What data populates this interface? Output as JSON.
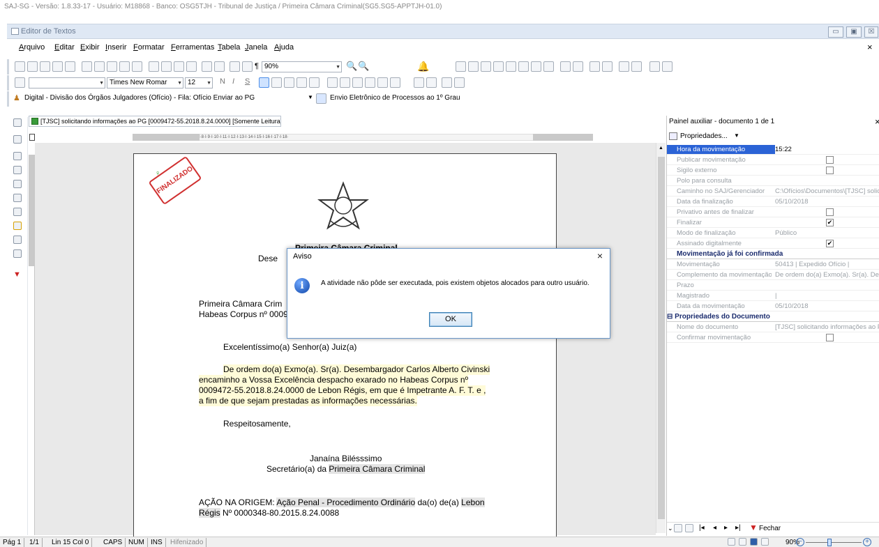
{
  "os_title": "SAJ-SG - Versão: 1.8.33-17 - Usuário: M18868 - Banco: OSG5TJH - Tribunal de Justiça / Primeira Câmara Criminal(SG5.SG5-APPTJH-01.0)",
  "editor": {
    "title": "Editor de Textos",
    "close_glyph": "×"
  },
  "menu": [
    "Arquivo",
    "Editar",
    "Exibir",
    "Inserir",
    "Formatar",
    "Ferramentas",
    "Tabela",
    "Janela",
    "Ajuda"
  ],
  "toolbar": {
    "zoom": "90%",
    "font_name": "Times New Romar",
    "font_size": "12",
    "queue_combo": "Digital - Divisão dos Órgãos Julgadores (Ofício) - Fila:  Ofício Enviar ao PG",
    "send_action": "Envio Eletrônico de Processos ao 1º Grau"
  },
  "doc_tab": "[TJSC] solicitando informações ao PG [0009472-55.2018.8.24.0000] [Somente Leitura]",
  "ruler_text": "·3·I·2·I·1·I··I·1·I·2·I·3·I·4·I·5·I·6·I·7·I·8·I·9·I·10·I·11·I·12·I·13·I·14·I·15·I·16·I·17·I·18·",
  "document": {
    "stamp": "FINALIZADO",
    "chamber_heading": "Primeira Câmara Criminal",
    "desembargador_prefix": "Dese",
    "line_chamber": "Primeira Câmara Crim",
    "line_hc": "Habeas Corpus nº 0009",
    "salutation": "Excelentíssimo(a) Senhor(a) Juiz(a)",
    "body_lines": [
      "De ordem do(a) Exmo(a). Sr(a). Desembargador Carlos Alberto Civinski",
      "encaminho a Vossa Excelência despacho exarado no Habeas Corpus nº",
      "0009472-55.2018.8.24.0000 de Lebon Régis, em que é Impetrante A. F. T. e ,",
      "a fim de que sejam prestadas as informações necessárias."
    ],
    "closing": "Respeitosamente,",
    "signer_name": "Janaína Bilésssimo",
    "signer_role_prefix": "Secretário(a) da ",
    "signer_role_org": "Primeira Câmara Criminal",
    "origin_label": "AÇÃO NA ORIGEM: ",
    "origin_type": "Ação Penal - Procedimento Ordinário",
    "origin_mid": " da(o)  de(a) ",
    "origin_city": "Lebon",
    "origin_line2_city": "Régis",
    "origin_line2_num": " Nº 0000348-80.2015.8.24.0088"
  },
  "dialog": {
    "title": "Aviso",
    "message": "A atividade não pôde ser executada, pois existem objetos alocados para outro usuário.",
    "ok": "OK",
    "close": "×"
  },
  "panel": {
    "title": "Painel auxiliar - documento 1 de 1",
    "close": "×",
    "props_label": "Propriedades...",
    "rows": [
      {
        "k": "Hora da movimentação",
        "v": "15:22",
        "selected": true
      },
      {
        "k": "Publicar movimentação",
        "v": "",
        "cb": ""
      },
      {
        "k": "Sigilo externo",
        "v": "",
        "cb": ""
      },
      {
        "k": "Polo para consulta",
        "v": ""
      },
      {
        "k": "Caminho no SAJ/Gerenciador",
        "v": "C:\\Ofícios\\Documentos\\[TJSC] solicit"
      },
      {
        "k": "Data da finalização",
        "v": "05/10/2018"
      },
      {
        "k": "Privativo antes de finalizar",
        "v": "",
        "cb": ""
      },
      {
        "k": "Finalizar",
        "v": "",
        "cb": "✔"
      },
      {
        "k": "Modo de finalização",
        "v": "Público"
      },
      {
        "k": "Assinado digitalmente",
        "v": "",
        "cb": "✔"
      }
    ],
    "section1": "Movimentação já foi confirmada",
    "rows2": [
      {
        "k": "Movimentação",
        "v": "50413    | Expedido Ofício    |"
      },
      {
        "k": "Complemento da movimentação",
        "v": "De ordem do(a) Exmo(a). Sr(a). Dese..."
      },
      {
        "k": "Prazo",
        "v": ""
      },
      {
        "k": "Magistrado",
        "v": "|"
      },
      {
        "k": "Data da movimentação",
        "v": "05/10/2018"
      }
    ],
    "section2": "Propriedades do Documento",
    "rows3": [
      {
        "k": "Nome do documento",
        "v": "[TJSC] solicitando informações ao PG."
      },
      {
        "k": "Confirmar movimentação",
        "v": "",
        "cb": ""
      }
    ],
    "fechar": "Fechar"
  },
  "status": {
    "page": "Pág 1",
    "pages": "1/1",
    "lin_col": "Lin 15  Col 0",
    "caps": "CAPS",
    "num": "NUM",
    "ins": "INS",
    "hif": "Hifenizado",
    "zoom": "90%"
  }
}
